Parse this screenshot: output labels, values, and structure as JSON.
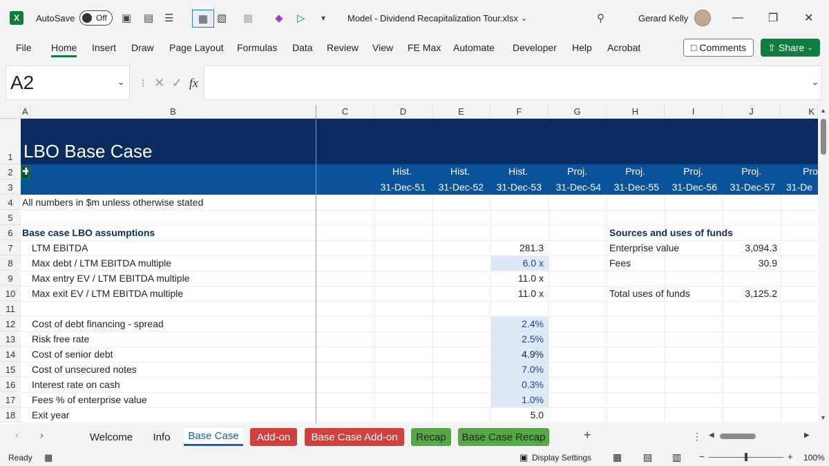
{
  "titlebar": {
    "autosave_label": "AutoSave",
    "autosave_state": "Off",
    "document_title": "Model - Dividend Recapitalization Tour.xlsx",
    "user_name": "Gerard Kelly"
  },
  "ribbon": {
    "tabs": [
      "File",
      "Home",
      "Insert",
      "Draw",
      "Page Layout",
      "Formulas",
      "Data",
      "Review",
      "View",
      "FE Max",
      "Automate",
      "Developer",
      "Help",
      "Acrobat"
    ],
    "active_tab": "Home",
    "comments_label": "Comments",
    "share_label": "Share"
  },
  "formula_bar": {
    "name_box": "A2",
    "fx_label": "fx",
    "formula": ""
  },
  "columns": [
    "A",
    "B",
    "C",
    "D",
    "E",
    "F",
    "G",
    "H",
    "I",
    "J",
    "K"
  ],
  "rows": [
    "1",
    "2",
    "3",
    "4",
    "5",
    "6",
    "7",
    "8",
    "9",
    "10",
    "11",
    "12",
    "13",
    "14",
    "15",
    "16",
    "17",
    "18"
  ],
  "sheet": {
    "title": "LBO Base Case",
    "period_types": [
      "Hist.",
      "Hist.",
      "Hist.",
      "Proj.",
      "Proj.",
      "Proj.",
      "Proj.",
      "Pro"
    ],
    "period_dates": [
      "31-Dec-51",
      "31-Dec-52",
      "31-Dec-53",
      "31-Dec-54",
      "31-Dec-55",
      "31-Dec-56",
      "31-Dec-57",
      "31-De"
    ],
    "note": "All numbers in $m unless otherwise stated",
    "assumptions_title": "Base case LBO assumptions",
    "assumptions": [
      {
        "label": "LTM EBITDA",
        "value": "281.3"
      },
      {
        "label": "Max debt / LTM EBITDA multiple",
        "value": "6.0 x"
      },
      {
        "label": "Max entry EV / LTM EBITDA multiple",
        "value": "11.0 x"
      },
      {
        "label": "Max exit EV / LTM EBITDA multiple",
        "value": "11.0 x"
      },
      {
        "label": "Cost of debt financing - spread",
        "value": "2.4%"
      },
      {
        "label": "Risk free rate",
        "value": "2.5%"
      },
      {
        "label": "Cost of senior debt",
        "value": "4.9%"
      },
      {
        "label": "Cost of unsecured notes",
        "value": "7.0%"
      },
      {
        "label": "Interest rate on cash",
        "value": "0.3%"
      },
      {
        "label": "Fees % of enterprise value",
        "value": "1.0%"
      },
      {
        "label": "Exit year",
        "value": "5.0"
      }
    ],
    "sources_title": "Sources and uses of funds",
    "sources": [
      {
        "label": "Enterprise value",
        "value": "3,094.3"
      },
      {
        "label": "Fees",
        "value": "30.9"
      },
      {
        "label": "Total uses of funds",
        "value": "3,125.2"
      }
    ]
  },
  "sheet_tabs": [
    "Welcome",
    "Info",
    "Base Case",
    "Add-on",
    "Base Case Add-on",
    "Recap",
    "Base Case Recap"
  ],
  "statusbar": {
    "ready": "Ready",
    "display_settings": "Display Settings",
    "zoom": "100%"
  }
}
